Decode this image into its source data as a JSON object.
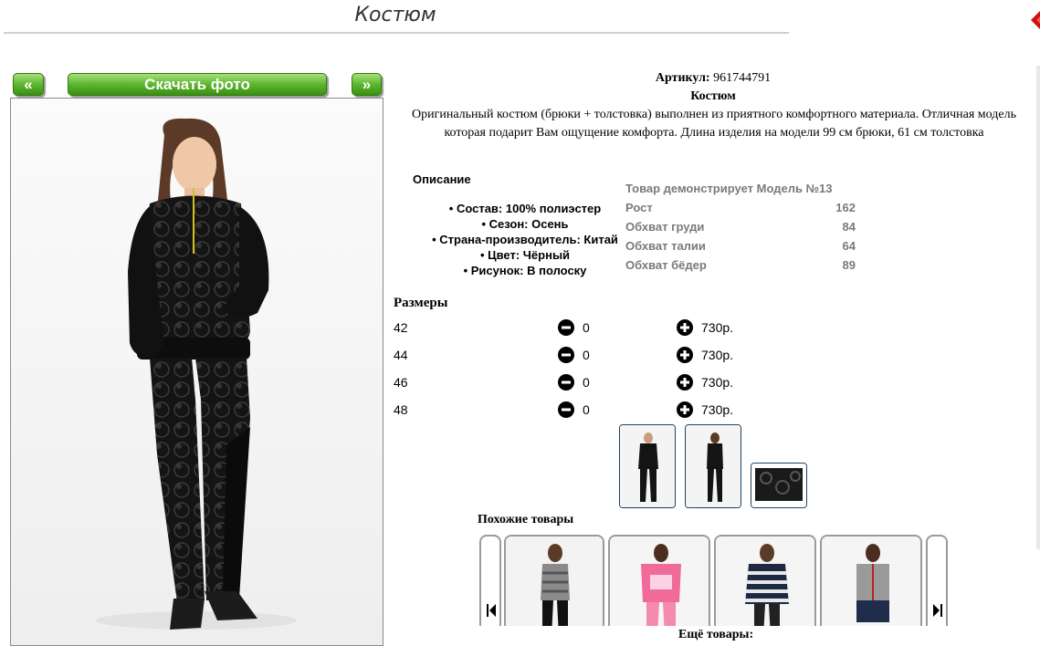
{
  "page": {
    "title": "Костюм"
  },
  "photo_nav": {
    "prev_label": "«",
    "download_label": "Скачать фото",
    "next_label": "»"
  },
  "product": {
    "sku_label": "Артикул:",
    "sku_value": "961744791",
    "name": "Костюм",
    "description": "Оригинальный костюм (брюки + толстовка) выполнен из приятного комфортного материала. Отличная модель которая подарит Вам ощущение комфорта. Длина изделия на модели 99 см брюки, 61 см толстовка",
    "description_heading": "Описание",
    "properties": [
      "Состав: 100% полиэстер",
      "Сезон: Осень",
      "Страна-производитель: Китай",
      "Цвет: Чёрный",
      "Рисунок: В полоску"
    ]
  },
  "model": {
    "heading": "Товар демонстрирует Модель №13",
    "measurements": [
      {
        "label": "Рост",
        "value": "162"
      },
      {
        "label": "Обхват груди",
        "value": "84"
      },
      {
        "label": "Обхват талии",
        "value": "64"
      },
      {
        "label": "Обхват бёдер",
        "value": "89"
      }
    ]
  },
  "sizes": {
    "heading": "Размеры",
    "rows": [
      {
        "size": "42",
        "qty": "0",
        "price": "730р."
      },
      {
        "size": "44",
        "qty": "0",
        "price": "730р."
      },
      {
        "size": "46",
        "qty": "0",
        "price": "730р."
      },
      {
        "size": "48",
        "qty": "0",
        "price": "730р."
      }
    ]
  },
  "similar": {
    "heading": "Похожие товары",
    "more_heading": "Ещё товары:"
  },
  "colors": {
    "button_green": "#5db62e",
    "thumb_border": "#23415e",
    "close_red": "#cc1111"
  },
  "icons": {
    "close": "close-icon",
    "minus": "minus-circle-icon",
    "plus": "plus-circle-icon",
    "carousel_prev": "skip-prev-icon",
    "carousel_next": "skip-next-icon"
  }
}
